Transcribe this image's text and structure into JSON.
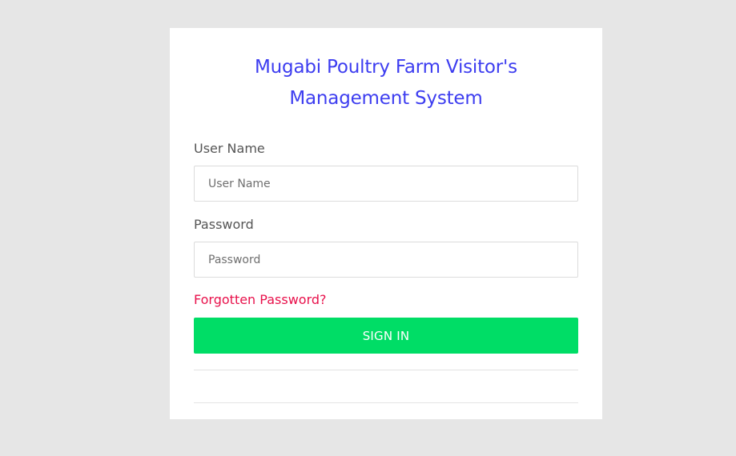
{
  "login": {
    "title_line1": "Mugabi Poultry Farm Visitor's",
    "title_line2": "Management System",
    "username_label": "User Name",
    "username_placeholder": "User Name",
    "username_value": "",
    "password_label": "Password",
    "password_placeholder": "Password",
    "password_value": "",
    "forgot_link": "Forgotten Password?",
    "signin_button": "SIGN IN"
  },
  "colors": {
    "background": "#e6e6e6",
    "card": "#ffffff",
    "title": "#3d3df0",
    "link": "#e8114b",
    "button": "#00dd66",
    "button_text": "#ffffff"
  }
}
